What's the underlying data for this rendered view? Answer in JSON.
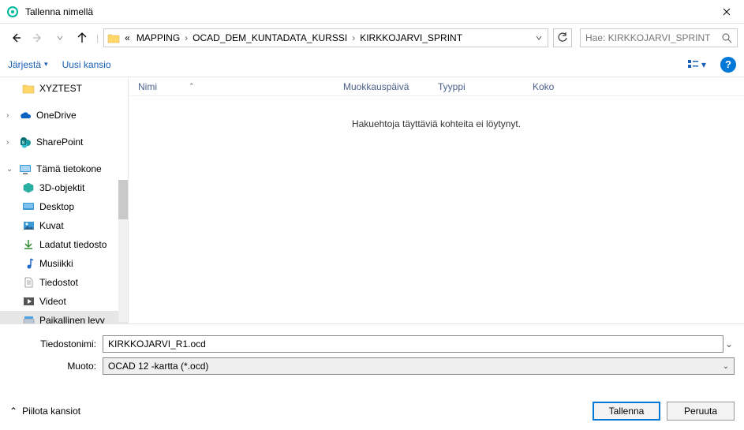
{
  "title": "Tallenna nimellä",
  "breadcrumb": {
    "prefix": "«",
    "items": [
      "MAPPING",
      "OCAD_DEM_KUNTADATA_KURSSI",
      "KIRKKOJARVI_SPRINT"
    ]
  },
  "search_placeholder": "Hae: KIRKKOJARVI_SPRINT",
  "toolbar": {
    "organize": "Järjestä",
    "new_folder": "Uusi kansio"
  },
  "tree": {
    "xyztest": "XYZTEST",
    "onedrive": "OneDrive",
    "sharepoint": "SharePoint",
    "this_pc": "Tämä tietokone",
    "objects3d": "3D-objektit",
    "desktop": "Desktop",
    "pictures": "Kuvat",
    "downloads": "Ladatut tiedosto",
    "music": "Musiikki",
    "documents": "Tiedostot",
    "videos": "Videot",
    "local_disk": "Paikallinen levy "
  },
  "columns": {
    "name": "Nimi",
    "modified": "Muokkauspäivä",
    "type": "Tyyppi",
    "size": "Koko"
  },
  "empty_message": "Hakuehtoja täyttäviä kohteita ei löytynyt.",
  "form": {
    "filename_label": "Tiedostonimi:",
    "filename_value": "KIRKKOJARVI_R1.ocd",
    "format_label": "Muoto:",
    "format_value": "OCAD 12 -kartta (*.ocd)"
  },
  "footer": {
    "hide_folders": "Piilota kansiot",
    "save": "Tallenna",
    "cancel": "Peruuta"
  }
}
